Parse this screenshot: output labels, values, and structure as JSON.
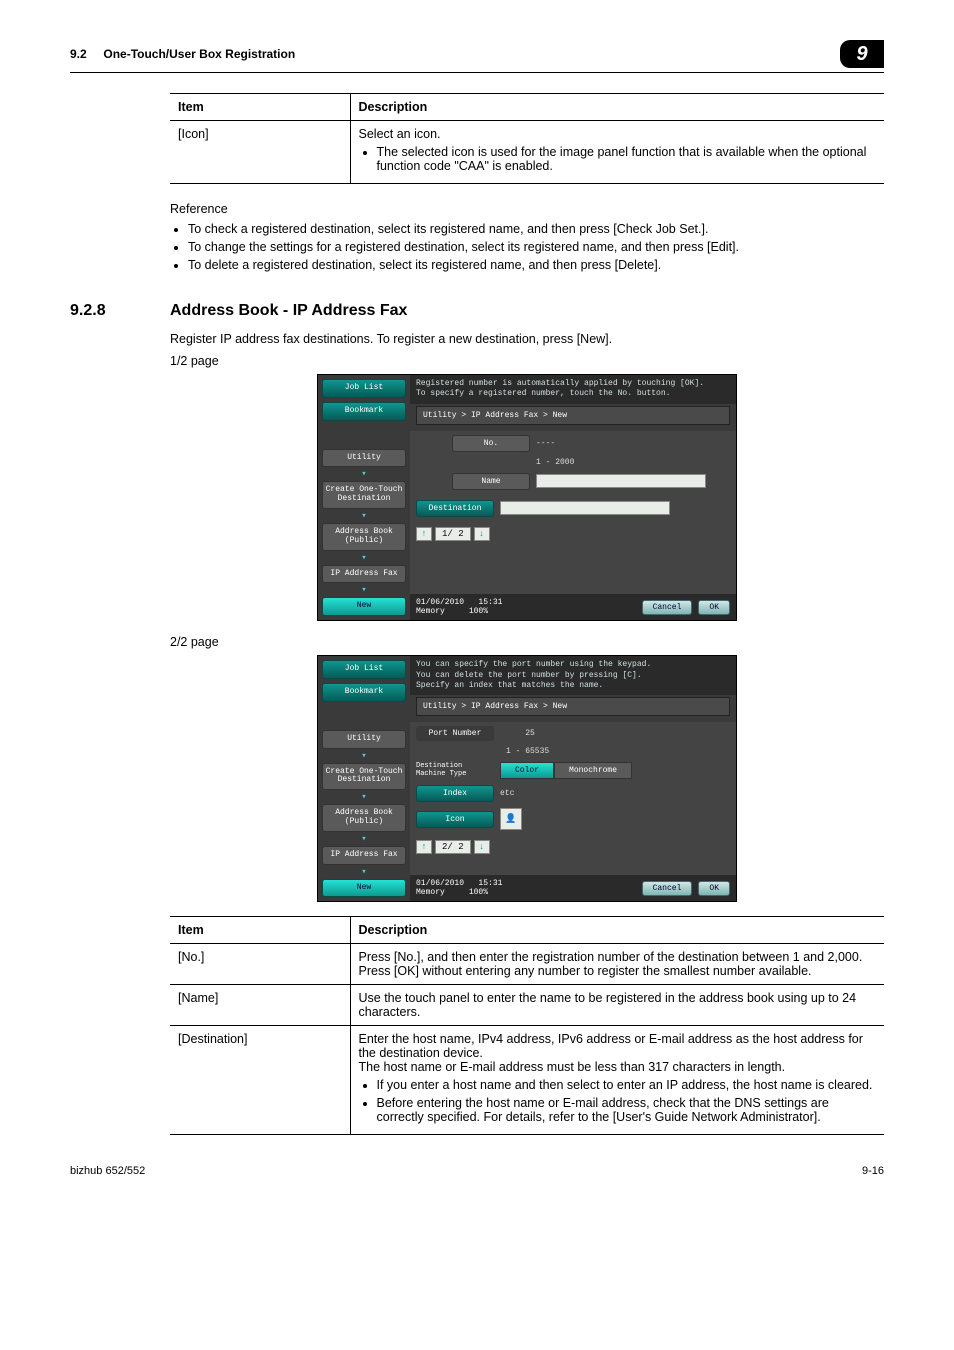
{
  "header": {
    "section_no": "9.2",
    "section_title": "One-Touch/User Box Registration",
    "chapter_chip": "9"
  },
  "table1": {
    "head_item": "Item",
    "head_desc": "Description",
    "rows": [
      {
        "item": "[Icon]",
        "desc_line1": "Select an icon.",
        "bullets": [
          "The selected icon is used for the image panel function that is available when the optional function code \"CAA\" is enabled."
        ]
      }
    ]
  },
  "reference": {
    "label": "Reference",
    "bullets": [
      "To check a registered destination, select its registered name, and then press [Check Job Set.].",
      "To change the settings for a registered destination, select its registered name, and then press [Edit].",
      "To delete a registered destination, select its registered name, and then press [Delete]."
    ]
  },
  "section928": {
    "num": "9.2.8",
    "title": "Address Book - IP Address Fax",
    "intro": "Register IP address fax destinations. To register a new destination, press [New].",
    "page1_label": "1/2 page",
    "page2_label": "2/2 page"
  },
  "shot1": {
    "sidebar": {
      "job_list": "Job List",
      "bookmark": "Bookmark",
      "utility": "Utility",
      "create": "Create One-Touch Destination",
      "address": "Address Book (Public)",
      "ipfax": "IP Address Fax",
      "new": "New"
    },
    "top": "Registered number is automatically applied by touching [OK].\nTo specify a registered number, touch the No. button.",
    "breadcrumb": "Utility > IP Address Fax > New",
    "labels": {
      "no": "No.",
      "name": "Name",
      "dest": "Destination"
    },
    "no_val": "----",
    "range": "1 - 2000",
    "pager": "1/ 2",
    "footer_date": "01/06/2010",
    "footer_time": "15:31",
    "footer_mem": "Memory",
    "footer_mem_val": "100%",
    "cancel": "Cancel",
    "ok": "OK"
  },
  "shot2": {
    "top": "You can specify the port number using the keypad.\nYou can delete the port number by pressing [C].\nSpecify an index that matches the name.",
    "breadcrumb": "Utility > IP Address Fax > New",
    "labels": {
      "port": "Port Number",
      "machine": "Destination Machine Type",
      "index": "Index",
      "icon": "Icon"
    },
    "port_val": "25",
    "port_range": "1 - 65535",
    "color": "Color",
    "mono": "Monochrome",
    "index_val": "etc",
    "pager": "2/ 2",
    "footer_date": "01/06/2010",
    "footer_time": "15:31",
    "footer_mem": "Memory",
    "footer_mem_val": "100%",
    "cancel": "Cancel",
    "ok": "OK"
  },
  "table2": {
    "head_item": "Item",
    "head_desc": "Description",
    "rows": [
      {
        "item": "[No.]",
        "desc": "Press [No.], and then enter the registration number of the destination between 1 and 2,000. Press [OK] without entering any number to register the smallest number available."
      },
      {
        "item": "[Name]",
        "desc": "Use the touch panel to enter the name to be registered in the address book using up to 24 characters."
      },
      {
        "item": "[Destination]",
        "desc1": "Enter the host name, IPv4 address, IPv6 address or E-mail address as the host address for the destination device.",
        "desc2": "The host name or E-mail address must be less than 317 characters in length.",
        "bullets": [
          "If you enter a host name and then select to enter an IP address, the host name is cleared.",
          "Before entering the host name or E-mail address, check that the DNS settings are correctly specified. For details, refer to the [User's Guide Network Administrator]."
        ]
      }
    ]
  },
  "footer": {
    "left": "bizhub 652/552",
    "right": "9-16"
  }
}
